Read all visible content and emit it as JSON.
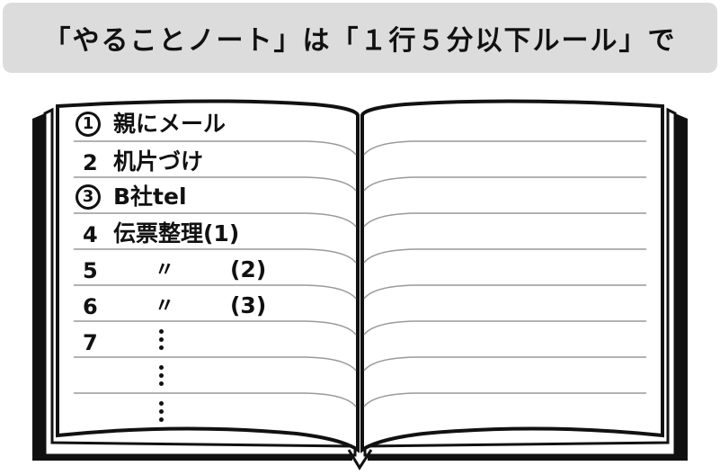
{
  "banner": {
    "title": "「やることノート」は「１行５分以下ルール」で"
  },
  "rows": [
    {
      "num": "1",
      "circled": true,
      "text": "親にメール"
    },
    {
      "num": "2",
      "circled": false,
      "text": "机片づけ"
    },
    {
      "num": "3",
      "circled": true,
      "text": "B社tel"
    },
    {
      "num": "4",
      "circled": false,
      "text": "伝票整理(1)"
    },
    {
      "num": "5",
      "circled": false,
      "ditto": "〃",
      "paren": "(2)"
    },
    {
      "num": "6",
      "circled": false,
      "ditto": "〃",
      "paren": "(3)"
    },
    {
      "num": "7",
      "circled": false
    }
  ],
  "colors": {
    "line": "#999999",
    "ink": "#111111",
    "banner_bg": "#dcdcdc"
  }
}
